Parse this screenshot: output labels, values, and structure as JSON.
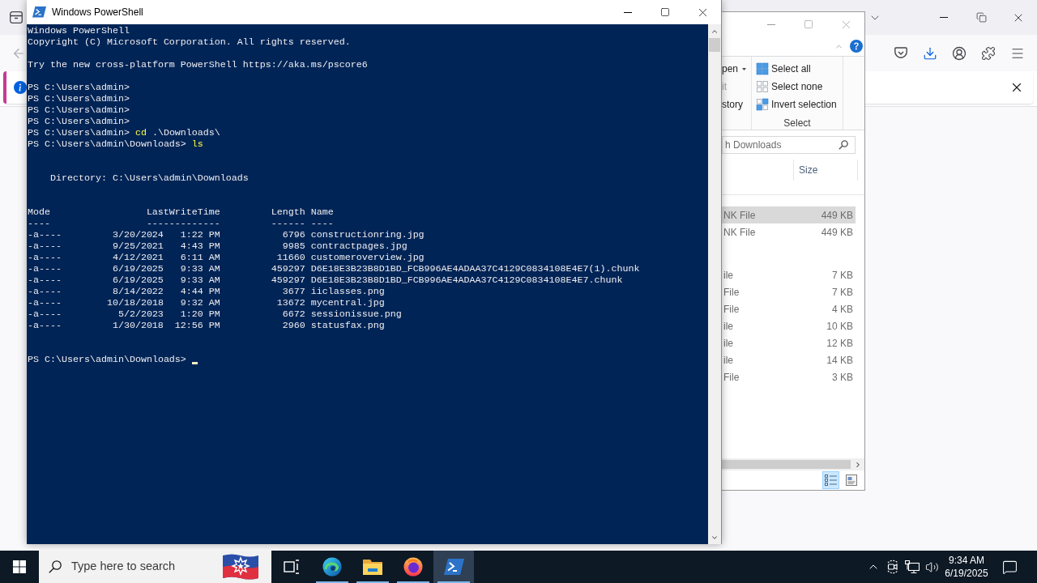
{
  "powershell": {
    "title": "Windows PowerShell",
    "console": {
      "banner": [
        "Windows PowerShell",
        "Copyright (C) Microsoft Corporation. All rights reserved."
      ],
      "notice": "Try the new cross-platform PowerShell https://aka.ms/pscore6",
      "history": [
        {
          "prompt": "PS C:\\Users\\admin>"
        },
        {
          "prompt": "PS C:\\Users\\admin>"
        },
        {
          "prompt": "PS C:\\Users\\admin>"
        },
        {
          "prompt": "PS C:\\Users\\admin>"
        },
        {
          "prompt": "PS C:\\Users\\admin>",
          "command": "cd",
          "argument": ".\\Downloads\\"
        },
        {
          "prompt": "PS C:\\Users\\admin\\Downloads>",
          "command": "ls"
        }
      ],
      "directory": "Directory: C:\\Users\\admin\\Downloads",
      "listing": {
        "columns": [
          "Mode",
          "LastWriteTime",
          "Length",
          "Name"
        ],
        "rules": [
          "----",
          "-------------",
          "------",
          "----"
        ],
        "rows": [
          {
            "mode": "-a----",
            "date": "3/20/2024",
            "time": "1:22 PM",
            "length": "6796",
            "name": "constructionring.jpg"
          },
          {
            "mode": "-a----",
            "date": "9/25/2021",
            "time": "4:43 PM",
            "length": "9985",
            "name": "contractpages.jpg"
          },
          {
            "mode": "-a----",
            "date": "4/12/2021",
            "time": "6:11 AM",
            "length": "11660",
            "name": "customeroverview.jpg"
          },
          {
            "mode": "-a----",
            "date": "6/19/2025",
            "time": "9:33 AM",
            "length": "459297",
            "name": "D6E18E3B23B8D1BD_FCB996AE4ADAA37C4129C0834108E4E7(1).chunk"
          },
          {
            "mode": "-a----",
            "date": "6/19/2025",
            "time": "9:33 AM",
            "length": "459297",
            "name": "D6E18E3B23B8D1BD_FCB996AE4ADAA37C4129C0834108E4E7.chunk"
          },
          {
            "mode": "-a----",
            "date": "8/14/2022",
            "time": "4:44 PM",
            "length": "3677",
            "name": "iiclasses.png"
          },
          {
            "mode": "-a----",
            "date": "10/18/2018",
            "time": "9:32 AM",
            "length": "13672",
            "name": "mycentral.jpg"
          },
          {
            "mode": "-a----",
            "date": "5/2/2023",
            "time": "1:20 PM",
            "length": "6672",
            "name": "sessionissue.png"
          },
          {
            "mode": "-a----",
            "date": "1/30/2018",
            "time": "12:56 PM",
            "length": "2960",
            "name": "statusfax.png"
          }
        ]
      },
      "prompt": "PS C:\\Users\\admin\\Downloads>",
      "cursor_visible": true
    }
  },
  "explorer": {
    "ribbon": {
      "clipped_items": [
        {
          "label": "pen",
          "dropdown": true,
          "disabled": false
        },
        {
          "label": "it",
          "dropdown": false,
          "disabled": true
        },
        {
          "label": "story",
          "dropdown": false,
          "disabled": false
        }
      ],
      "select_group": {
        "items": [
          {
            "label": "Select all",
            "kind": "select-all"
          },
          {
            "label": "Select none",
            "kind": "select-none"
          },
          {
            "label": "Invert selection",
            "kind": "invert"
          }
        ],
        "label": "Select"
      }
    },
    "search": {
      "placeholder": "h Downloads"
    },
    "columns": [
      "Size"
    ],
    "file_groups": [
      {
        "rows": [
          {
            "type": "NK File",
            "size": "449 KB",
            "selected": true
          },
          {
            "type": "NK File",
            "size": "449 KB",
            "selected": false
          }
        ]
      },
      {
        "rows": [
          {
            "type": "ile",
            "size": "7 KB",
            "selected": false
          },
          {
            "type": "File",
            "size": "7 KB",
            "selected": false
          },
          {
            "type": "File",
            "size": "4 KB",
            "selected": false
          },
          {
            "type": "ile",
            "size": "10 KB",
            "selected": false
          },
          {
            "type": "ile",
            "size": "12 KB",
            "selected": false
          },
          {
            "type": "ile",
            "size": "14 KB",
            "selected": false
          },
          {
            "type": "File",
            "size": "3 KB",
            "selected": false
          }
        ]
      }
    ],
    "view_buttons": [
      {
        "kind": "details",
        "selected": true
      },
      {
        "kind": "large-icons",
        "selected": false
      }
    ]
  },
  "taskbar": {
    "search": {
      "placeholder": "Type here to search"
    },
    "apps": [
      {
        "kind": "task-view",
        "running": false,
        "selected": false
      },
      {
        "kind": "edge",
        "running": true,
        "selected": false
      },
      {
        "kind": "file-explorer",
        "running": true,
        "selected": false
      },
      {
        "kind": "firefox",
        "running": true,
        "selected": false
      },
      {
        "kind": "powershell",
        "running": true,
        "selected": true
      }
    ],
    "clock": {
      "time": "9:34 AM",
      "date": "6/19/2025"
    }
  }
}
